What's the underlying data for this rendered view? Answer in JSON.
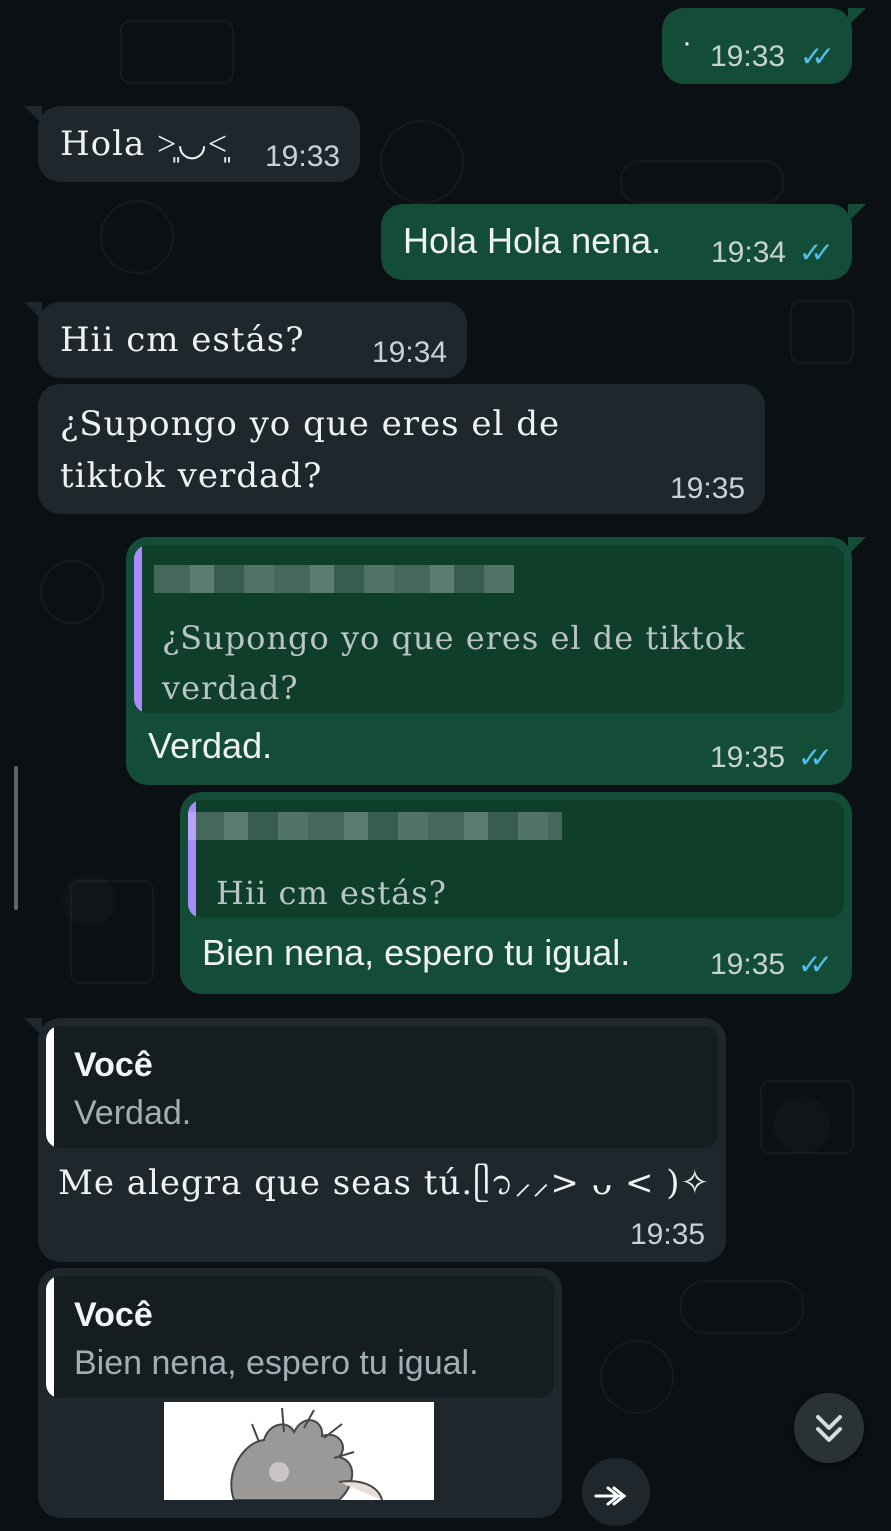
{
  "chat": {
    "messages": [
      {
        "direction": "out",
        "text": "·",
        "time": "19:33",
        "status": "read"
      },
      {
        "direction": "in",
        "text": "Hola ˃͈◡˂͈",
        "time": "19:33"
      },
      {
        "direction": "out",
        "text": "Hola Hola nena.",
        "time": "19:34",
        "status": "read"
      },
      {
        "direction": "in",
        "text": "Hii cm estás?",
        "time": "19:34"
      },
      {
        "direction": "in",
        "text_line1": "¿Supongo yo que eres el de",
        "text_line2": "tiktok verdad?",
        "time": "19:35"
      },
      {
        "direction": "out",
        "quote_line1": "¿Supongo yo que eres el de tiktok",
        "quote_line2": "verdad?",
        "text": "Verdad.",
        "time": "19:35",
        "status": "read"
      },
      {
        "direction": "out",
        "quote": "Hii cm estás?",
        "text": "Bien nena, espero tu igual.",
        "time": "19:35",
        "status": "read"
      },
      {
        "direction": "in",
        "quote_author": "Você",
        "quote": "Verdad.",
        "text": "Me alegra que seas tú.ᥫ᭡⸝⸝> ᴗ < )✧",
        "time": "19:35"
      },
      {
        "direction": "in",
        "quote_author": "Você",
        "quote": "Bien nena, espero tu igual."
      }
    ]
  },
  "icons": {
    "read_receipt": "double-check-icon",
    "scroll_down": "double-chevron-down-icon",
    "forward": "forward-icon"
  },
  "colors": {
    "background": "#0b1014",
    "incoming_bubble": "#1f272c",
    "outgoing_bubble": "#144d37",
    "read_check": "#53bdeb",
    "quote_bar_outgoing": "#a78bfa",
    "quote_bar_incoming": "#ffffff"
  }
}
